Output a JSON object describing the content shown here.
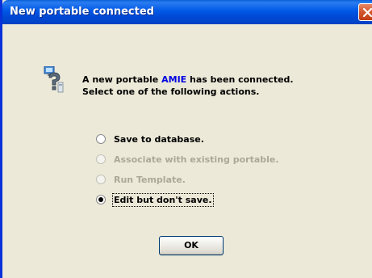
{
  "window": {
    "title": "New portable connected",
    "close_icon": "close-icon"
  },
  "message": {
    "icon": "portable-question-icon",
    "line1_prefix": "A new portable ",
    "line1_device": "AMIE",
    "line1_suffix": " has been connected.",
    "line2": "Select one of the following actions.",
    "device_color": "#0000e0"
  },
  "options": [
    {
      "label": "Save to database.",
      "enabled": true,
      "selected": false
    },
    {
      "label": "Associate with existing portable.",
      "enabled": false,
      "selected": false
    },
    {
      "label": "Run Template.",
      "enabled": false,
      "selected": false
    },
    {
      "label": "Edit but don't save.",
      "enabled": true,
      "selected": true
    }
  ],
  "buttons": {
    "ok_label": "OK"
  },
  "colors": {
    "titlebar": "#0058e6",
    "dialog_bg": "#ece9d8",
    "disabled_text": "#aca899"
  }
}
